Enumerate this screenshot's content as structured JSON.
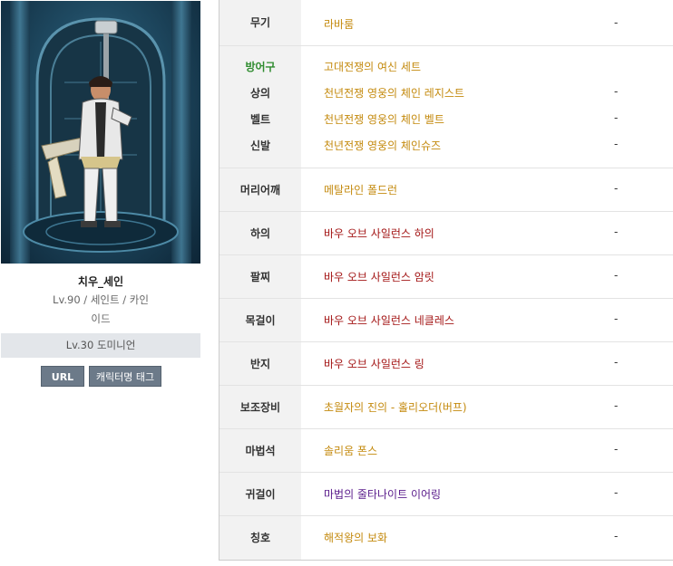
{
  "character": {
    "name": "치우_세인",
    "info_line1": "Lv.90 / 세인트 / 카인",
    "info_line2": "이드",
    "adventure": "Lv.30 도미니언",
    "url_button": "URL",
    "tag_button": "캐릭터명 태그"
  },
  "equipment": {
    "weapon": {
      "slot": "무기",
      "item": "라바룸",
      "extra": "-"
    },
    "armor": {
      "group_label": "방어구",
      "set_name": "고대전쟁의 여신 세트",
      "items": [
        {
          "slot": "상의",
          "item": "천년전쟁 영웅의 체인 레지스트",
          "extra": "-"
        },
        {
          "slot": "벨트",
          "item": "천년전쟁 영웅의 체인 벨트",
          "extra": "-"
        },
        {
          "slot": "신발",
          "item": "천년전쟁 영웅의 체인슈즈",
          "extra": "-"
        }
      ]
    },
    "shoulder": {
      "slot": "머리어깨",
      "item": "메탈라인 폴드런",
      "extra": "-"
    },
    "pants": {
      "slot": "하의",
      "item": "바우 오브 사일런스 하의",
      "extra": "-"
    },
    "bracelet": {
      "slot": "팔찌",
      "item": "바우 오브 사일런스 암릿",
      "extra": "-"
    },
    "necklace": {
      "slot": "목걸이",
      "item": "바우 오브 사일런스 네클레스",
      "extra": "-"
    },
    "ring": {
      "slot": "반지",
      "item": "바우 오브 사일런스 링",
      "extra": "-"
    },
    "support": {
      "slot": "보조장비",
      "item": "초월자의 진의 - 홀리오더(버프)",
      "extra": "-"
    },
    "magic_stone": {
      "slot": "마법석",
      "item": "솔리움 폰스",
      "extra": "-"
    },
    "earring": {
      "slot": "귀걸이",
      "item": "마법의 줄타나이트 이어링",
      "extra": "-"
    },
    "title": {
      "slot": "칭호",
      "item": "해적왕의 보화",
      "extra": "-"
    }
  },
  "colors": {
    "epic_gold": "#c48a0e",
    "unique_red": "#a31515",
    "legendary_purple": "#5b1d8c",
    "set_green": "#2f8c2f"
  }
}
